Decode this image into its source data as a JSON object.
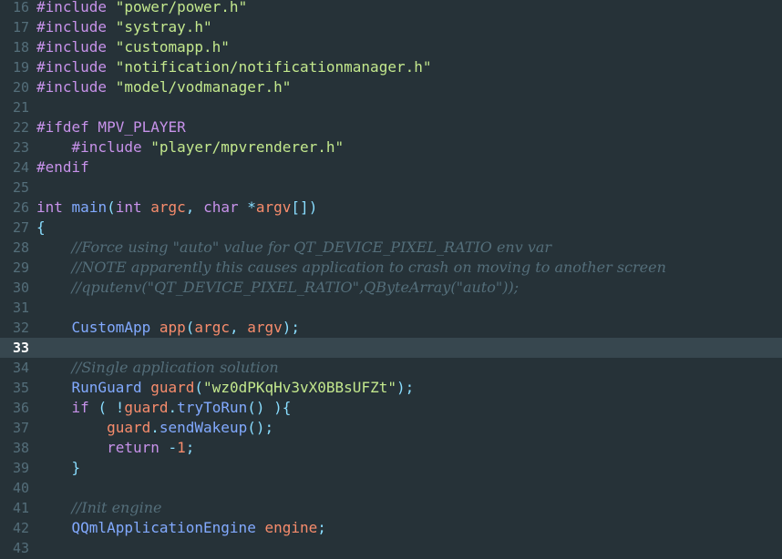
{
  "editor": {
    "current_line": 33,
    "colors": {
      "background": "#263238",
      "current_line_background": "#37474f",
      "line_number": "#546e7a",
      "keyword": "#c792ea",
      "string": "#c3e88d",
      "type": "#82aaff",
      "variable": "#f78c6c",
      "punctuation": "#89ddff",
      "comment": "#546e7a",
      "plain": "#eeffff"
    },
    "lines": [
      {
        "number": "16",
        "tokens": [
          {
            "t": "macro",
            "v": "#include"
          },
          {
            "t": "plain",
            "v": " "
          },
          {
            "t": "string",
            "v": "\"power/power.h\""
          }
        ]
      },
      {
        "number": "17",
        "tokens": [
          {
            "t": "macro",
            "v": "#include"
          },
          {
            "t": "plain",
            "v": " "
          },
          {
            "t": "string",
            "v": "\"systray.h\""
          }
        ]
      },
      {
        "number": "18",
        "tokens": [
          {
            "t": "macro",
            "v": "#include"
          },
          {
            "t": "plain",
            "v": " "
          },
          {
            "t": "string",
            "v": "\"customapp.h\""
          }
        ]
      },
      {
        "number": "19",
        "tokens": [
          {
            "t": "macro",
            "v": "#include"
          },
          {
            "t": "plain",
            "v": " "
          },
          {
            "t": "string",
            "v": "\"notification/notificationmanager.h\""
          }
        ]
      },
      {
        "number": "20",
        "tokens": [
          {
            "t": "macro",
            "v": "#include"
          },
          {
            "t": "plain",
            "v": " "
          },
          {
            "t": "string",
            "v": "\"model/vodmanager.h\""
          }
        ]
      },
      {
        "number": "21",
        "tokens": []
      },
      {
        "number": "22",
        "tokens": [
          {
            "t": "macro",
            "v": "#ifdef MPV_PLAYER"
          }
        ]
      },
      {
        "number": "23",
        "tokens": [
          {
            "t": "plain",
            "v": "    "
          },
          {
            "t": "macro",
            "v": "#include"
          },
          {
            "t": "plain",
            "v": " "
          },
          {
            "t": "string",
            "v": "\"player/mpvrenderer.h\""
          }
        ]
      },
      {
        "number": "24",
        "tokens": [
          {
            "t": "macro",
            "v": "#endif"
          }
        ]
      },
      {
        "number": "25",
        "tokens": []
      },
      {
        "number": "26",
        "tokens": [
          {
            "t": "keyword",
            "v": "int"
          },
          {
            "t": "plain",
            "v": " "
          },
          {
            "t": "func",
            "v": "main"
          },
          {
            "t": "punct",
            "v": "("
          },
          {
            "t": "keyword",
            "v": "int"
          },
          {
            "t": "plain",
            "v": " "
          },
          {
            "t": "var",
            "v": "argc"
          },
          {
            "t": "punct",
            "v": ","
          },
          {
            "t": "plain",
            "v": " "
          },
          {
            "t": "keyword",
            "v": "char"
          },
          {
            "t": "plain",
            "v": " "
          },
          {
            "t": "operator",
            "v": "*"
          },
          {
            "t": "var",
            "v": "argv"
          },
          {
            "t": "punct",
            "v": "[])"
          }
        ]
      },
      {
        "number": "27",
        "tokens": [
          {
            "t": "punct",
            "v": "{"
          }
        ]
      },
      {
        "number": "28",
        "tokens": [
          {
            "t": "plain",
            "v": "    "
          },
          {
            "t": "comment",
            "v": "//Force using \"auto\" value for QT_DEVICE_PIXEL_RATIO env var"
          }
        ]
      },
      {
        "number": "29",
        "tokens": [
          {
            "t": "plain",
            "v": "    "
          },
          {
            "t": "comment",
            "v": "//NOTE apparently this causes application to crash on moving to another screen"
          }
        ]
      },
      {
        "number": "30",
        "tokens": [
          {
            "t": "plain",
            "v": "    "
          },
          {
            "t": "comment",
            "v": "//qputenv(\"QT_DEVICE_PIXEL_RATIO\",QByteArray(\"auto\"));"
          }
        ]
      },
      {
        "number": "31",
        "tokens": []
      },
      {
        "number": "32",
        "tokens": [
          {
            "t": "plain",
            "v": "    "
          },
          {
            "t": "type",
            "v": "CustomApp"
          },
          {
            "t": "plain",
            "v": " "
          },
          {
            "t": "var",
            "v": "app"
          },
          {
            "t": "punct",
            "v": "("
          },
          {
            "t": "var",
            "v": "argc"
          },
          {
            "t": "punct",
            "v": ","
          },
          {
            "t": "plain",
            "v": " "
          },
          {
            "t": "var",
            "v": "argv"
          },
          {
            "t": "punct",
            "v": ");"
          }
        ]
      },
      {
        "number": "33",
        "tokens": []
      },
      {
        "number": "34",
        "tokens": [
          {
            "t": "plain",
            "v": "    "
          },
          {
            "t": "comment",
            "v": "//Single application solution"
          }
        ]
      },
      {
        "number": "35",
        "tokens": [
          {
            "t": "plain",
            "v": "    "
          },
          {
            "t": "type",
            "v": "RunGuard"
          },
          {
            "t": "plain",
            "v": " "
          },
          {
            "t": "var",
            "v": "guard"
          },
          {
            "t": "punct",
            "v": "("
          },
          {
            "t": "string",
            "v": "\"wz0dPKqHv3vX0BBsUFZt\""
          },
          {
            "t": "punct",
            "v": ");"
          }
        ]
      },
      {
        "number": "36",
        "tokens": [
          {
            "t": "plain",
            "v": "    "
          },
          {
            "t": "keyword",
            "v": "if"
          },
          {
            "t": "plain",
            "v": " "
          },
          {
            "t": "punct",
            "v": "("
          },
          {
            "t": "plain",
            "v": " "
          },
          {
            "t": "operator",
            "v": "!"
          },
          {
            "t": "var",
            "v": "guard"
          },
          {
            "t": "punct",
            "v": "."
          },
          {
            "t": "func",
            "v": "tryToRun"
          },
          {
            "t": "punct",
            "v": "()"
          },
          {
            "t": "plain",
            "v": " "
          },
          {
            "t": "punct",
            "v": "){"
          }
        ]
      },
      {
        "number": "37",
        "tokens": [
          {
            "t": "plain",
            "v": "        "
          },
          {
            "t": "var",
            "v": "guard"
          },
          {
            "t": "punct",
            "v": "."
          },
          {
            "t": "func",
            "v": "sendWakeup"
          },
          {
            "t": "punct",
            "v": "();"
          }
        ]
      },
      {
        "number": "38",
        "tokens": [
          {
            "t": "plain",
            "v": "        "
          },
          {
            "t": "keyword",
            "v": "return"
          },
          {
            "t": "plain",
            "v": " "
          },
          {
            "t": "operator",
            "v": "-"
          },
          {
            "t": "number",
            "v": "1"
          },
          {
            "t": "punct",
            "v": ";"
          }
        ]
      },
      {
        "number": "39",
        "tokens": [
          {
            "t": "plain",
            "v": "    "
          },
          {
            "t": "punct",
            "v": "}"
          }
        ]
      },
      {
        "number": "40",
        "tokens": []
      },
      {
        "number": "41",
        "tokens": [
          {
            "t": "plain",
            "v": "    "
          },
          {
            "t": "comment",
            "v": "//Init engine"
          }
        ]
      },
      {
        "number": "42",
        "tokens": [
          {
            "t": "plain",
            "v": "    "
          },
          {
            "t": "type",
            "v": "QQmlApplicationEngine"
          },
          {
            "t": "plain",
            "v": " "
          },
          {
            "t": "var",
            "v": "engine"
          },
          {
            "t": "punct",
            "v": ";"
          }
        ]
      },
      {
        "number": "43",
        "tokens": []
      }
    ]
  }
}
